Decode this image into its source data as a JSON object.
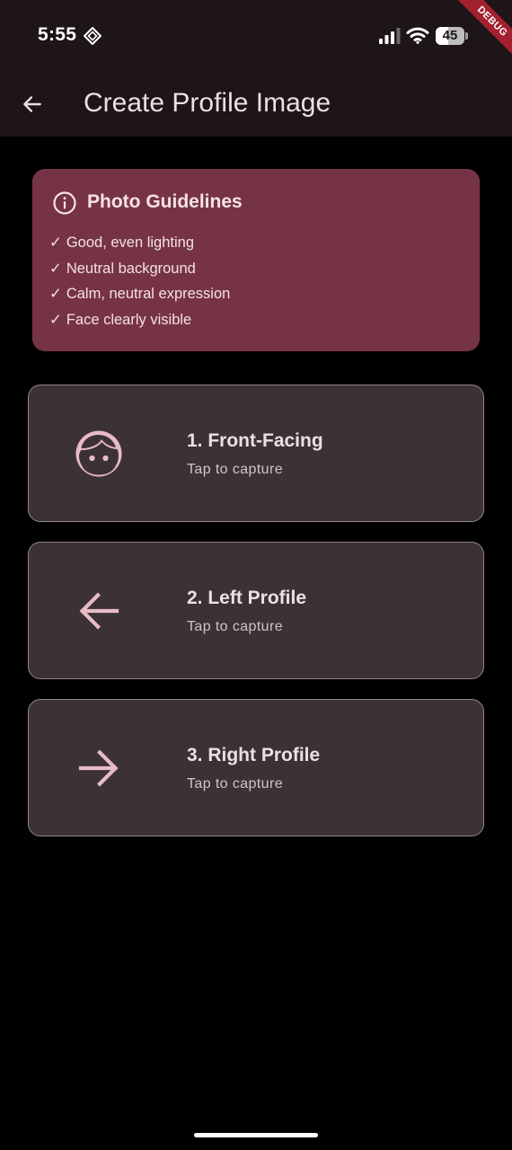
{
  "status_bar": {
    "time": "5:55",
    "battery_percent": "45",
    "battery_level": 0.45,
    "debug_label": "DEBUG"
  },
  "app_bar": {
    "title": "Create Profile Image",
    "back_icon": "arrow-back-icon"
  },
  "guidelines": {
    "title": "Photo Guidelines",
    "icon": "info-icon",
    "items": [
      {
        "check": "✓",
        "text": "Good, even lighting"
      },
      {
        "check": "✓",
        "text": "Neutral background"
      },
      {
        "check": "✓",
        "text": "Calm, neutral expression"
      },
      {
        "check": "✓",
        "text": "Face clearly visible"
      }
    ]
  },
  "captures": [
    {
      "title": "1. Front-Facing",
      "subtitle": "Tap to capture",
      "icon": "face-icon"
    },
    {
      "title": "2. Left Profile",
      "subtitle": "Tap to capture",
      "icon": "arrow-left-icon"
    },
    {
      "title": "3. Right Profile",
      "subtitle": "Tap to capture",
      "icon": "arrow-right-icon"
    }
  ],
  "colors": {
    "background": "#000000",
    "app_bar": "#1d1518",
    "guidelines_bg": "#773346",
    "card_bg": "#3c3236",
    "card_border": "#8f8589",
    "icon_accent": "#e8bcc7",
    "text_primary": "#ece0e2",
    "debug_banner": "#a3202e"
  }
}
